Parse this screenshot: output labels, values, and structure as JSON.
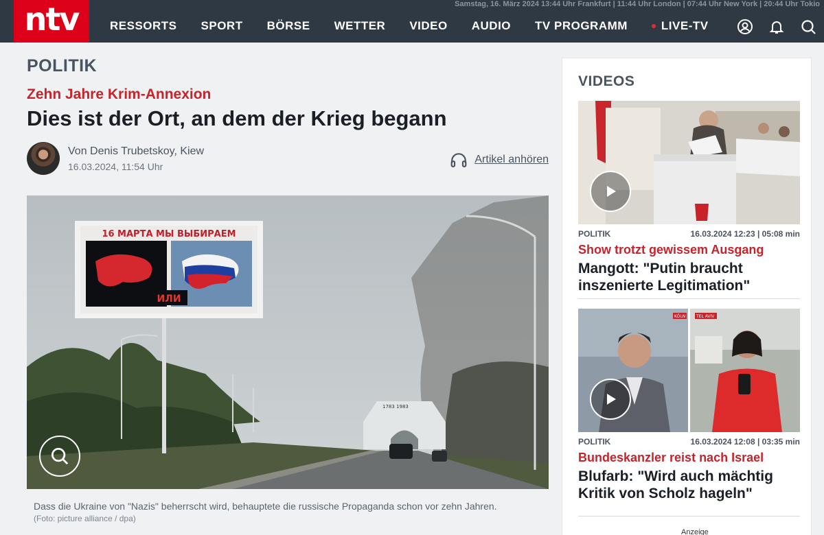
{
  "header": {
    "logo": "ntv",
    "datestrip": "Samstag, 16. März 2024 13:44 Uhr Frankfurt | 11:44 Uhr London | 07:44 Uhr New York | 20:44 Uhr Tokio",
    "nav": [
      "RESSORTS",
      "SPORT",
      "BÖRSE",
      "WETTER",
      "VIDEO",
      "AUDIO",
      "TV PROGRAMM",
      "LIVE-TV"
    ],
    "icons": [
      "user-icon",
      "bell-icon",
      "search-icon"
    ],
    "accent": "#dc0018",
    "background": "#2f3944"
  },
  "article": {
    "ressort": "POLITIK",
    "kicker": "Zehn Jahre Krim-Annexion",
    "headline": "Dies ist der Ort, an dem der Krieg begann",
    "author": "Von Denis Trubetskoy, Kiew",
    "date": "16.03.2024, 11:54 Uhr",
    "listen_label": "Artikel anhören",
    "image": {
      "billboard_text": "16 МАРТА МЫ ВЫБИРАЕМ",
      "billboard_or": "ИЛИ",
      "monument_years": "1783   1983"
    },
    "caption": "Dass die Ukraine von \"Nazis\" beherrscht wird, behauptete die russische Propaganda schon vor zehn Jahren.",
    "credit": "(Foto: picture alliance / dpa)"
  },
  "videos": {
    "title": "VIDEOS",
    "items": [
      {
        "category": "POLITIK",
        "meta": "16.03.2024 12:23 | 05:08 min",
        "kicker": "Show trotzt gewissem Ausgang",
        "title": "Mangott: \"Putin braucht inszenierte Legitimation\""
      },
      {
        "category": "POLITIK",
        "meta": "16.03.2024 12:08 | 03:35 min",
        "kicker": "Bundeskanzler reist nach Israel",
        "title": "Blufarb: \"Wird auch mächtig Kritik von Scholz hageln\"",
        "tag_left": "KÖLN",
        "tag_right": "TEL AVIV"
      }
    ]
  },
  "ad_label": "Anzeige"
}
